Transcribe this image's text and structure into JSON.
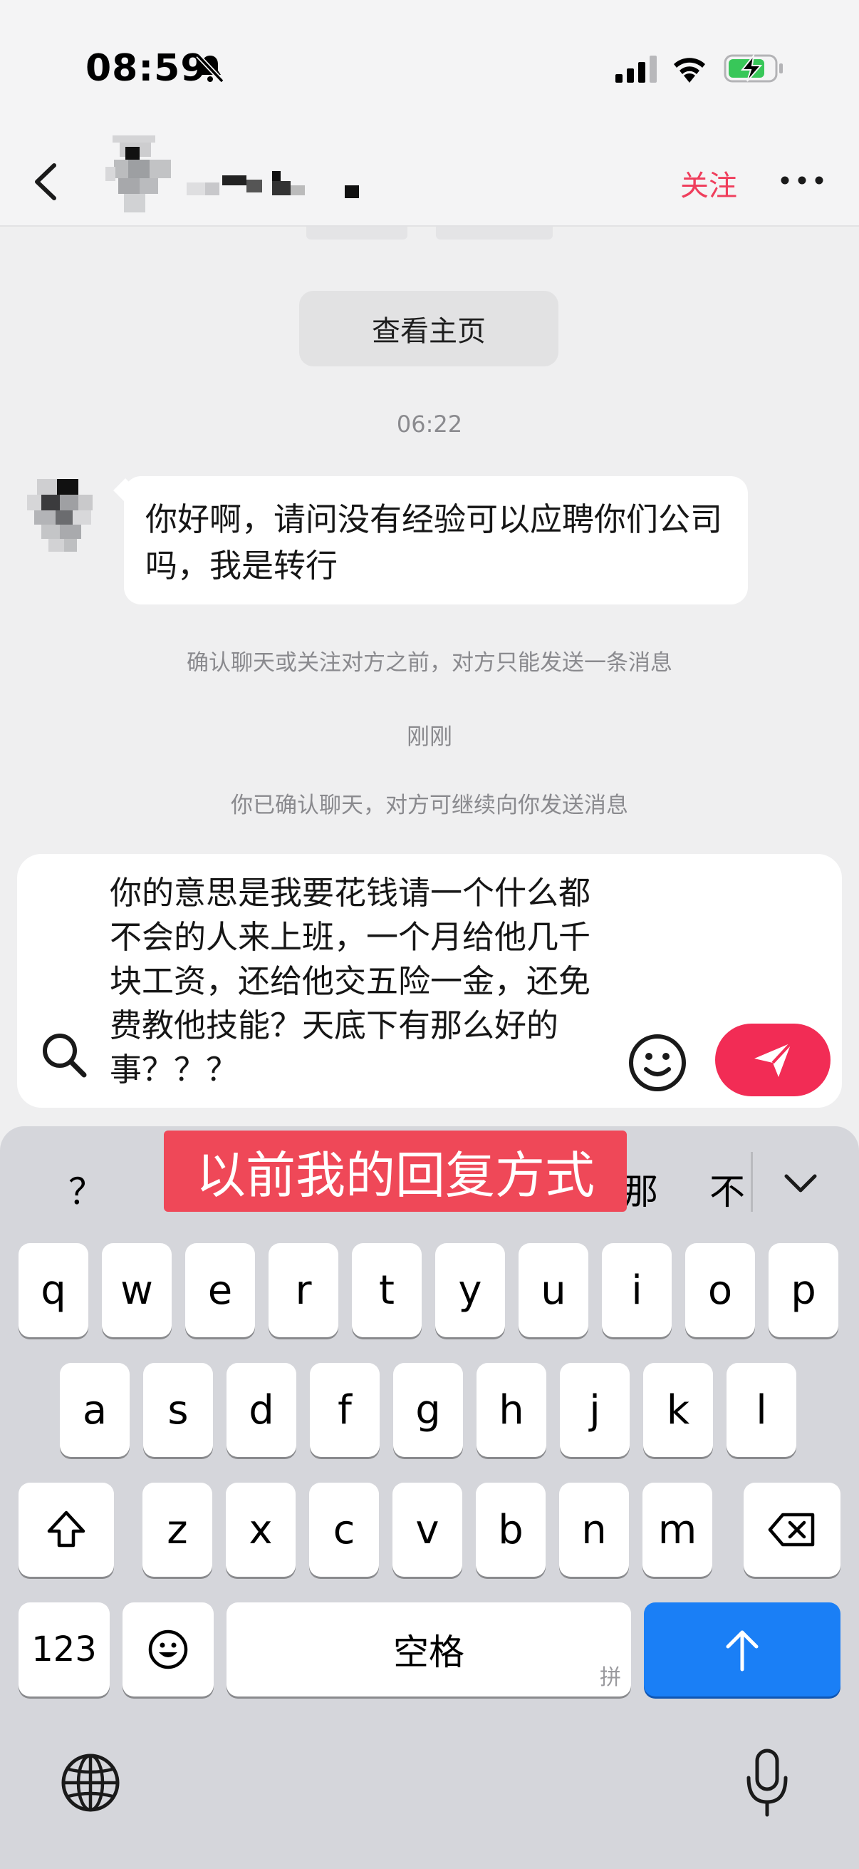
{
  "status_bar": {
    "time": "08:59"
  },
  "header": {
    "follow_label": "关注"
  },
  "chat": {
    "profile_button": "查看主页",
    "timestamp_1": "06:22",
    "incoming_message": "你好啊，请问没有经验可以应聘你们公司吗，我是转行",
    "system_note_1": "确认聊天或关注对方之前，对方只能发送一条消息",
    "timestamp_2": "刚刚",
    "system_note_2": "你已确认聊天，对方可继续向你发送消息"
  },
  "composer": {
    "draft_text": "你的意思是我要花钱请一个什么都不会的人来上班，一个月给他几千块工资，还给他交五险一金，还免费教他技能？天底下有那么好的事？？？"
  },
  "keyboard": {
    "candidates": [
      "？",
      "那",
      "不"
    ],
    "overlay_caption": "以前我的回复方式",
    "row1": [
      "q",
      "w",
      "e",
      "r",
      "t",
      "y",
      "u",
      "i",
      "o",
      "p"
    ],
    "row2": [
      "a",
      "s",
      "d",
      "f",
      "g",
      "h",
      "j",
      "k",
      "l"
    ],
    "row3": [
      "z",
      "x",
      "c",
      "v",
      "b",
      "n",
      "m"
    ],
    "numbers_key": "123",
    "space_label": "空格",
    "space_sub": "拼"
  },
  "colors": {
    "accent_red": "#f22c55",
    "follow_red": "#ef3e5c",
    "enter_blue": "#1a7ff6",
    "overlay_red": "#ef4858"
  }
}
